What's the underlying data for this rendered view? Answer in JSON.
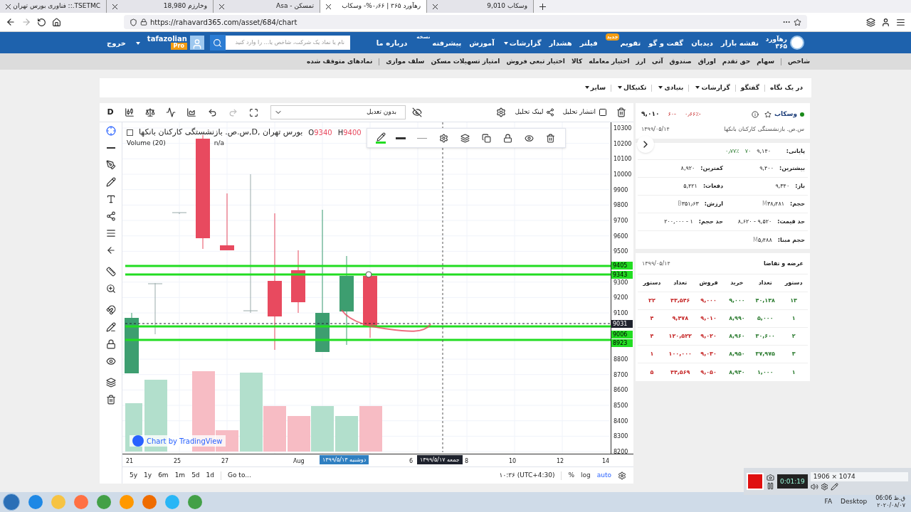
{
  "browser": {
    "tabs": [
      {
        "title": "وسکاب 9,010",
        "selected": false
      },
      {
        "title": "رهآورد ۳۶۵ | ۰٫۶۶%- وسکاب",
        "selected": true
      },
      {
        "title": "تمسکن - Asa",
        "selected": false
      },
      {
        "title": "وخارزم 18,980",
        "selected": false
      },
      {
        "title": "TSETMC.:: فناوری بورس تهران",
        "selected": false
      }
    ],
    "url": "https://rahavard365.com/asset/684/chart"
  },
  "site_header": {
    "logo": "رهآورد ۳۶۵",
    "nav": [
      {
        "label": "نقشه بازار",
        "kind": "link"
      },
      {
        "label": "دیدبان",
        "kind": "link"
      },
      {
        "label": "گفت و گو",
        "kind": "link"
      },
      {
        "label": "تقویم",
        "kind": "badge",
        "badge": "جدید"
      },
      {
        "label": "فیلتر",
        "kind": "link"
      },
      {
        "label": "هشدار",
        "kind": "link"
      },
      {
        "label": "گزارشات",
        "kind": "dropdown"
      },
      {
        "label": "آموزش",
        "kind": "link"
      },
      {
        "label": "پیشرفته",
        "kind": "badge",
        "badge": "نسخه"
      },
      {
        "label": "درباره ما",
        "kind": "link"
      }
    ],
    "search_placeholder": "نام یا نماد یک شرکت، شاخص یا... را وارد کنید",
    "user": "tafazolian",
    "plan": "Pro",
    "logout": "خروج"
  },
  "market_nav": [
    "شاخص",
    "سهام",
    "حق تقدم",
    "اوراق",
    "صندوق",
    "آتی",
    "ارز",
    "اختیار معامله",
    "کالا",
    "اختیار تبعی فروش",
    "امتیاز تسهیلات مسکن",
    "سلف موازی",
    "نمادهای متوقف شده"
  ],
  "analysis_nav": [
    {
      "label": "در یک نگاه",
      "kind": "link"
    },
    {
      "label": "گفتگو",
      "kind": "link"
    },
    {
      "label": "گزارشات",
      "kind": "dropdown"
    },
    {
      "label": "بنیادی",
      "kind": "dropdown"
    },
    {
      "label": "تکنیکال",
      "kind": "dropdown"
    },
    {
      "label": "سایر",
      "kind": "dropdown"
    }
  ],
  "chart": {
    "toolbar": {
      "interval": "D",
      "adjustment": "بدون تعدیل",
      "share_link": "لینک تحلیل",
      "publish": "انتشار تحلیل"
    },
    "legend": {
      "title": "بورس تهران ,D,س.ص. بازنشستگی کارکنان بانکها",
      "open_label": "O",
      "open": "9340",
      "high_label": "H",
      "high": "9400",
      "volume": "Volume (20)",
      "volume_value": "n/a"
    },
    "price_axis": [
      "10300",
      "10200",
      "10100",
      "10000",
      "9900",
      "9800",
      "9700",
      "9600",
      "9500",
      "9300",
      "9200",
      "9100",
      "8800",
      "8700",
      "8600",
      "8500",
      "8400",
      "8300",
      "8200"
    ],
    "levels": [
      {
        "label": "9405",
        "color": "#22dd22",
        "kind": "line"
      },
      {
        "label": "9343",
        "color": "#22dd22",
        "kind": "line"
      },
      {
        "label": "9031",
        "color": "#1e222d",
        "kind": "crosshair"
      },
      {
        "label": "9006",
        "color": "#22dd22",
        "kind": "line"
      },
      {
        "label": "8923",
        "color": "#22dd22",
        "kind": "line"
      }
    ],
    "time_axis": [
      "14",
      "12",
      "10",
      "8",
      "6",
      "Aug",
      "27",
      "25",
      "21"
    ],
    "date_badges": [
      {
        "label": "جمعه ۱۳۹۹/۵/۱۷",
        "color": "#1e222d"
      },
      {
        "label": "دوشنبه ۱۳۹۹/۵/۱۳",
        "color": "#2f7fc1"
      }
    ],
    "watermark": "Chart by TradingView",
    "ranges": [
      "1d",
      "5d",
      "1m",
      "6m",
      "1y",
      "5y"
    ],
    "goto": "Go to...",
    "clock": "۱۰:۳۶ (UTC+4:30)",
    "scale_options": [
      {
        "label": "auto",
        "selected": true
      },
      {
        "label": "log",
        "selected": false
      },
      {
        "label": "%",
        "selected": false
      }
    ]
  },
  "symbol_card": {
    "symbol": "وسکاب",
    "price": "۹,۰۱۰",
    "change": "-۶۰",
    "percent": "-۰٫۶۶٪",
    "company": "س.ص. بازنشستگی کارکنان بانکها",
    "date": "۱۳۹۹/۰۵/۱۴"
  },
  "stats": {
    "closing": {
      "label": "پایانی:",
      "value": "۹,۱۴۰",
      "change": "۷۰",
      "percent": "۰٫۷۷٪"
    },
    "rows": [
      [
        {
          "label": "بیشترین:",
          "value": "۹,۴۰۰"
        },
        {
          "label": "کمترین:",
          "value": "۸,۹۲۰"
        }
      ],
      [
        {
          "label": "باز:",
          "value": "۹,۳۴۰"
        },
        {
          "label": "دفعات:",
          "value": "۵,۴۲۱"
        }
      ],
      [
        {
          "label": "حجم:",
          "value": "۳۸٫۴۸۱",
          "unit": "M"
        },
        {
          "label": "ارزش:",
          "value": "۳۵۱٫۶۳",
          "unit": "B"
        }
      ],
      [
        {
          "label": "حد قیمت:",
          "value": "۹,۵۲۰ - ۸,۶۲۰"
        },
        {
          "label": "حد حجم:",
          "value": "۱ - ۲۰۰,۰۰۰"
        }
      ],
      [
        {
          "label": "حجم مبنا:",
          "value": "۵٫۴۸۸",
          "unit": "M"
        }
      ]
    ]
  },
  "order_book": {
    "title": "عرضه و تقاضا",
    "date": "۱۳۹۹/۰۵/۱۴",
    "columns": [
      "دستور",
      "تعداد",
      "خرید",
      "فروش",
      "تعداد",
      "دستور"
    ],
    "rows": [
      [
        "۱۳",
        "۴۰,۱۳۸",
        "۹,۰۰۰",
        "۹,۰۰۰",
        "۴۳,۵۴۶",
        "۲۲"
      ],
      [
        "۱",
        "۵,۰۰۰",
        "۸,۹۹۰",
        "۹,۰۱۰",
        "۹,۴۷۸",
        "۴"
      ],
      [
        "۲",
        "۳۰,۶۰۰",
        "۸,۹۶۰",
        "۹,۰۲۰",
        "۱۲۰,۵۲۲",
        "۴"
      ],
      [
        "۳",
        "۳۷,۹۷۵",
        "۸,۹۵۰",
        "۹,۰۳۰",
        "۱۰۰,۰۰۰",
        "۱"
      ],
      [
        "۱",
        "۱,۰۰۰",
        "۸,۹۴۰",
        "۹,۰۵۰",
        "۴۴,۵۶۹",
        "۵"
      ]
    ]
  },
  "recorder": {
    "timer": "0:01:19",
    "resolution": "1906 × 1074"
  },
  "taskbar": {
    "language": "FA",
    "desktop": "Desktop",
    "time": "ق.ظ 06:06",
    "date": "۲۰۲۰/۰۸/۰۷"
  }
}
